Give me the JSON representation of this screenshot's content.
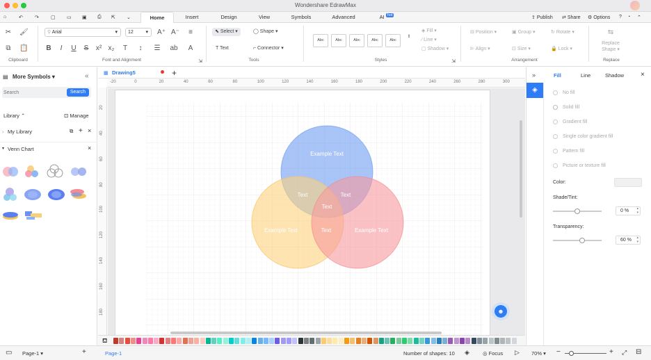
{
  "app": {
    "title": "Wondershare EdrawMax"
  },
  "menu": {
    "tabs": [
      "Home",
      "Insert",
      "Design",
      "View",
      "Symbols",
      "Advanced",
      "AI"
    ],
    "active_tab": "Home",
    "ai_badge": "hot",
    "right": {
      "publish": "Publish",
      "share": "Share",
      "options": "Options"
    }
  },
  "ribbon": {
    "font_name": "Arial",
    "font_size": "12",
    "select_label": "Select",
    "shape_label": "Shape",
    "text_label": "Text",
    "connector_label": "Connector",
    "style_swatch": "Abc",
    "fill_label": "Fill",
    "line_label": "Line",
    "shadow_label": "Shadow",
    "position_label": "Position",
    "group_label": "Group",
    "rotate_label": "Rotate",
    "align_label": "Align",
    "size_label": "Size",
    "lock_label": "Lock",
    "replace_shape_label1": "Replace",
    "replace_shape_label2": "Shape",
    "groups": {
      "clipboard": "Clipboard",
      "font": "Font and Alignment",
      "tools": "Tools",
      "styles": "Styles",
      "arrangement": "Arrangement",
      "replace": "Replace"
    }
  },
  "left_panel": {
    "title": "More Symbols",
    "search_placeholder": "Search",
    "search_button": "Search",
    "library_label": "Library",
    "manage_label": "Manage",
    "my_library": "My Library",
    "category": "Venn Chart"
  },
  "document": {
    "tab_name": "Drawing5"
  },
  "rulers": {
    "h_ticks": [
      "-20",
      "0",
      "20",
      "40",
      "60",
      "80",
      "100",
      "120",
      "140",
      "160",
      "180",
      "200",
      "220",
      "240",
      "260",
      "280",
      "300"
    ],
    "v_ticks": [
      "20",
      "40",
      "60",
      "80",
      "100",
      "120",
      "140",
      "160",
      "180"
    ]
  },
  "venn": {
    "circles": [
      {
        "label": "Example Text",
        "color": "#6f9cf2"
      },
      {
        "label": "Example Text",
        "color": "#fcd27d"
      },
      {
        "label": "Example Text",
        "color": "#f99a9e"
      }
    ],
    "intersections": [
      "Text",
      "Text",
      "Text",
      "Text"
    ]
  },
  "right_panel": {
    "tabs": [
      "Fill",
      "Line",
      "Shadow"
    ],
    "active_tab": "Fill",
    "options": [
      "No fill",
      "Solid fill",
      "Gradient fill",
      "Single color gradient fill",
      "Pattern fill",
      "Picture or texture fill"
    ],
    "color_label": "Color:",
    "shade_label": "Shade/Tint:",
    "shade_value": "0 %",
    "shade_level": 0.5,
    "transparency_label": "Transparency:",
    "transparency_value": "60 %",
    "transparency_level": 0.6
  },
  "palette": [
    "#c0392b",
    "#e74c3c",
    "#e84393",
    "#fd79a8",
    "#d63031",
    "#ff7675",
    "#e17055",
    "#fab1a0",
    "#00b894",
    "#55efc4",
    "#00cec9",
    "#81ecec",
    "#0984e3",
    "#74b9ff",
    "#6c5ce7",
    "#a29bfe",
    "#2d3436",
    "#636e72",
    "#fdcb6e",
    "#ffeaa7",
    "#f39c12",
    "#e67e22",
    "#d35400",
    "#16a085",
    "#27ae60",
    "#2ecc71",
    "#1abc9c",
    "#3498db",
    "#2980b9",
    "#9b59b6",
    "#8e44ad",
    "#34495e",
    "#95a5a6",
    "#7f8c8d",
    "#bdc3c7"
  ],
  "status": {
    "page_tab": "Page-1",
    "page_active": "Page-1",
    "shape_count": "Number of shapes: 10",
    "focus": "Focus",
    "zoom": "70%"
  }
}
